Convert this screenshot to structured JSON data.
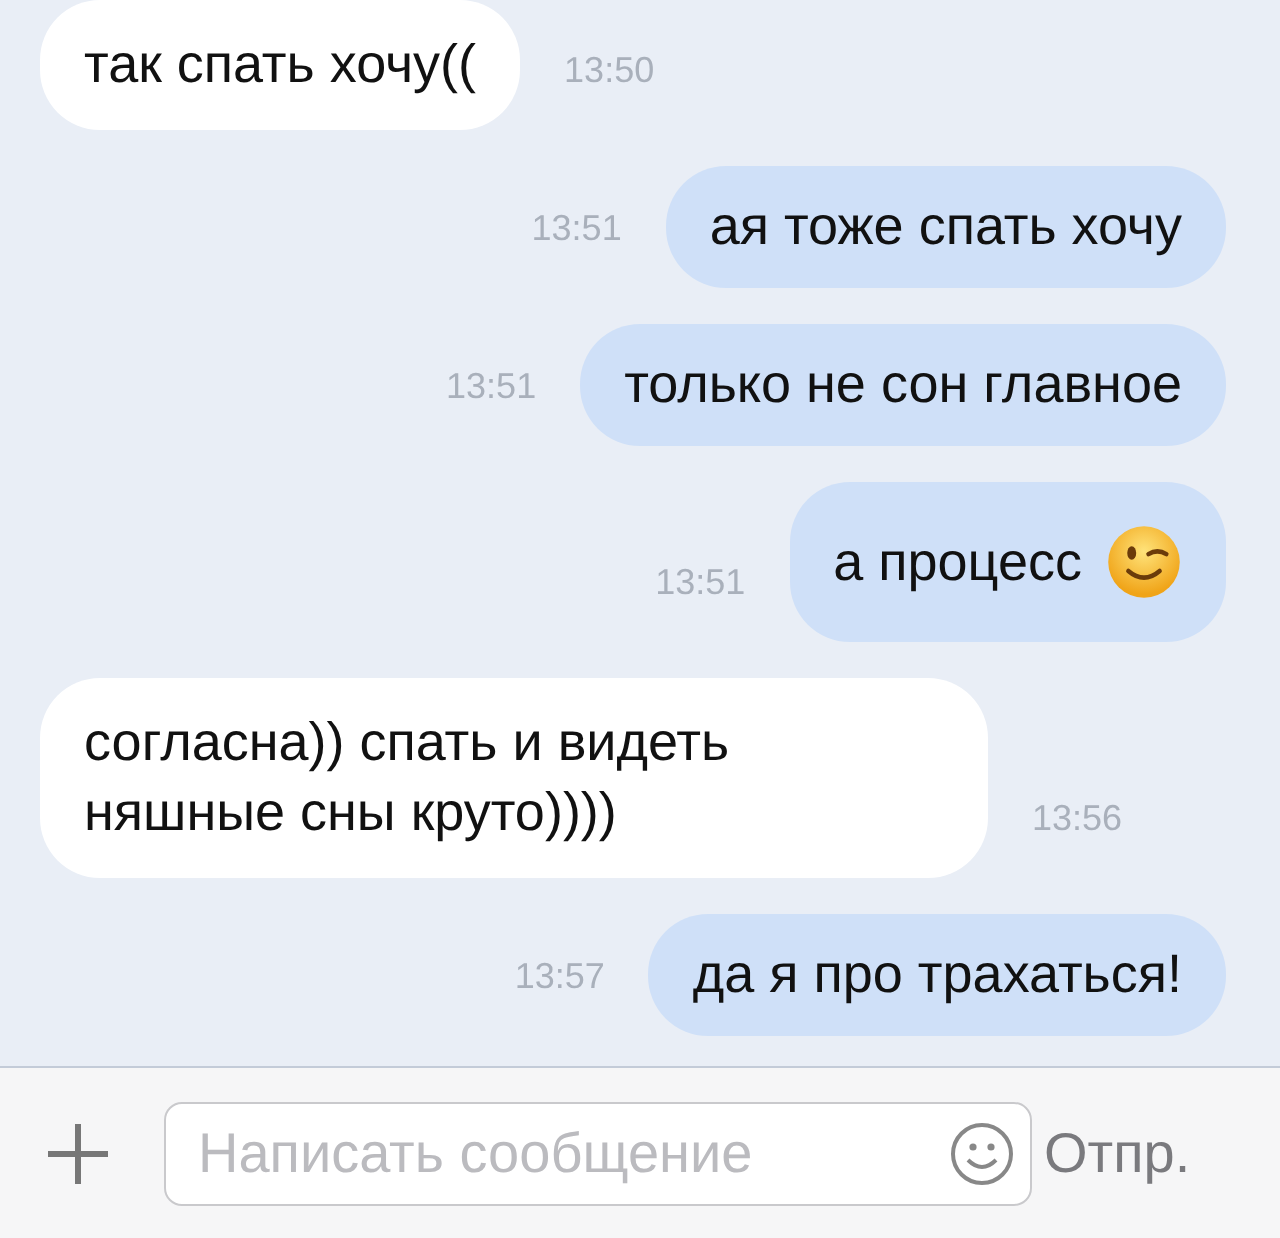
{
  "messages": [
    {
      "kind": "incoming",
      "text": "так спать хочу((",
      "time": "13:50",
      "emoji": false
    },
    {
      "kind": "outgoing",
      "text": "ая тоже спать хочу",
      "time": "13:51",
      "emoji": false
    },
    {
      "kind": "outgoing",
      "text": "только не сон главное",
      "time": "13:51",
      "emoji": false
    },
    {
      "kind": "outgoing",
      "text": "а процесс",
      "time": "13:51",
      "emoji": true
    },
    {
      "kind": "incoming",
      "text": "согласна)) спать и видеть няшные сны круто))))",
      "time": "13:56",
      "emoji": false
    },
    {
      "kind": "outgoing",
      "text": "да я про трахаться!",
      "time": "13:57",
      "emoji": false
    }
  ],
  "composer": {
    "placeholder": "Написать сообщение",
    "send": "Отпр."
  }
}
